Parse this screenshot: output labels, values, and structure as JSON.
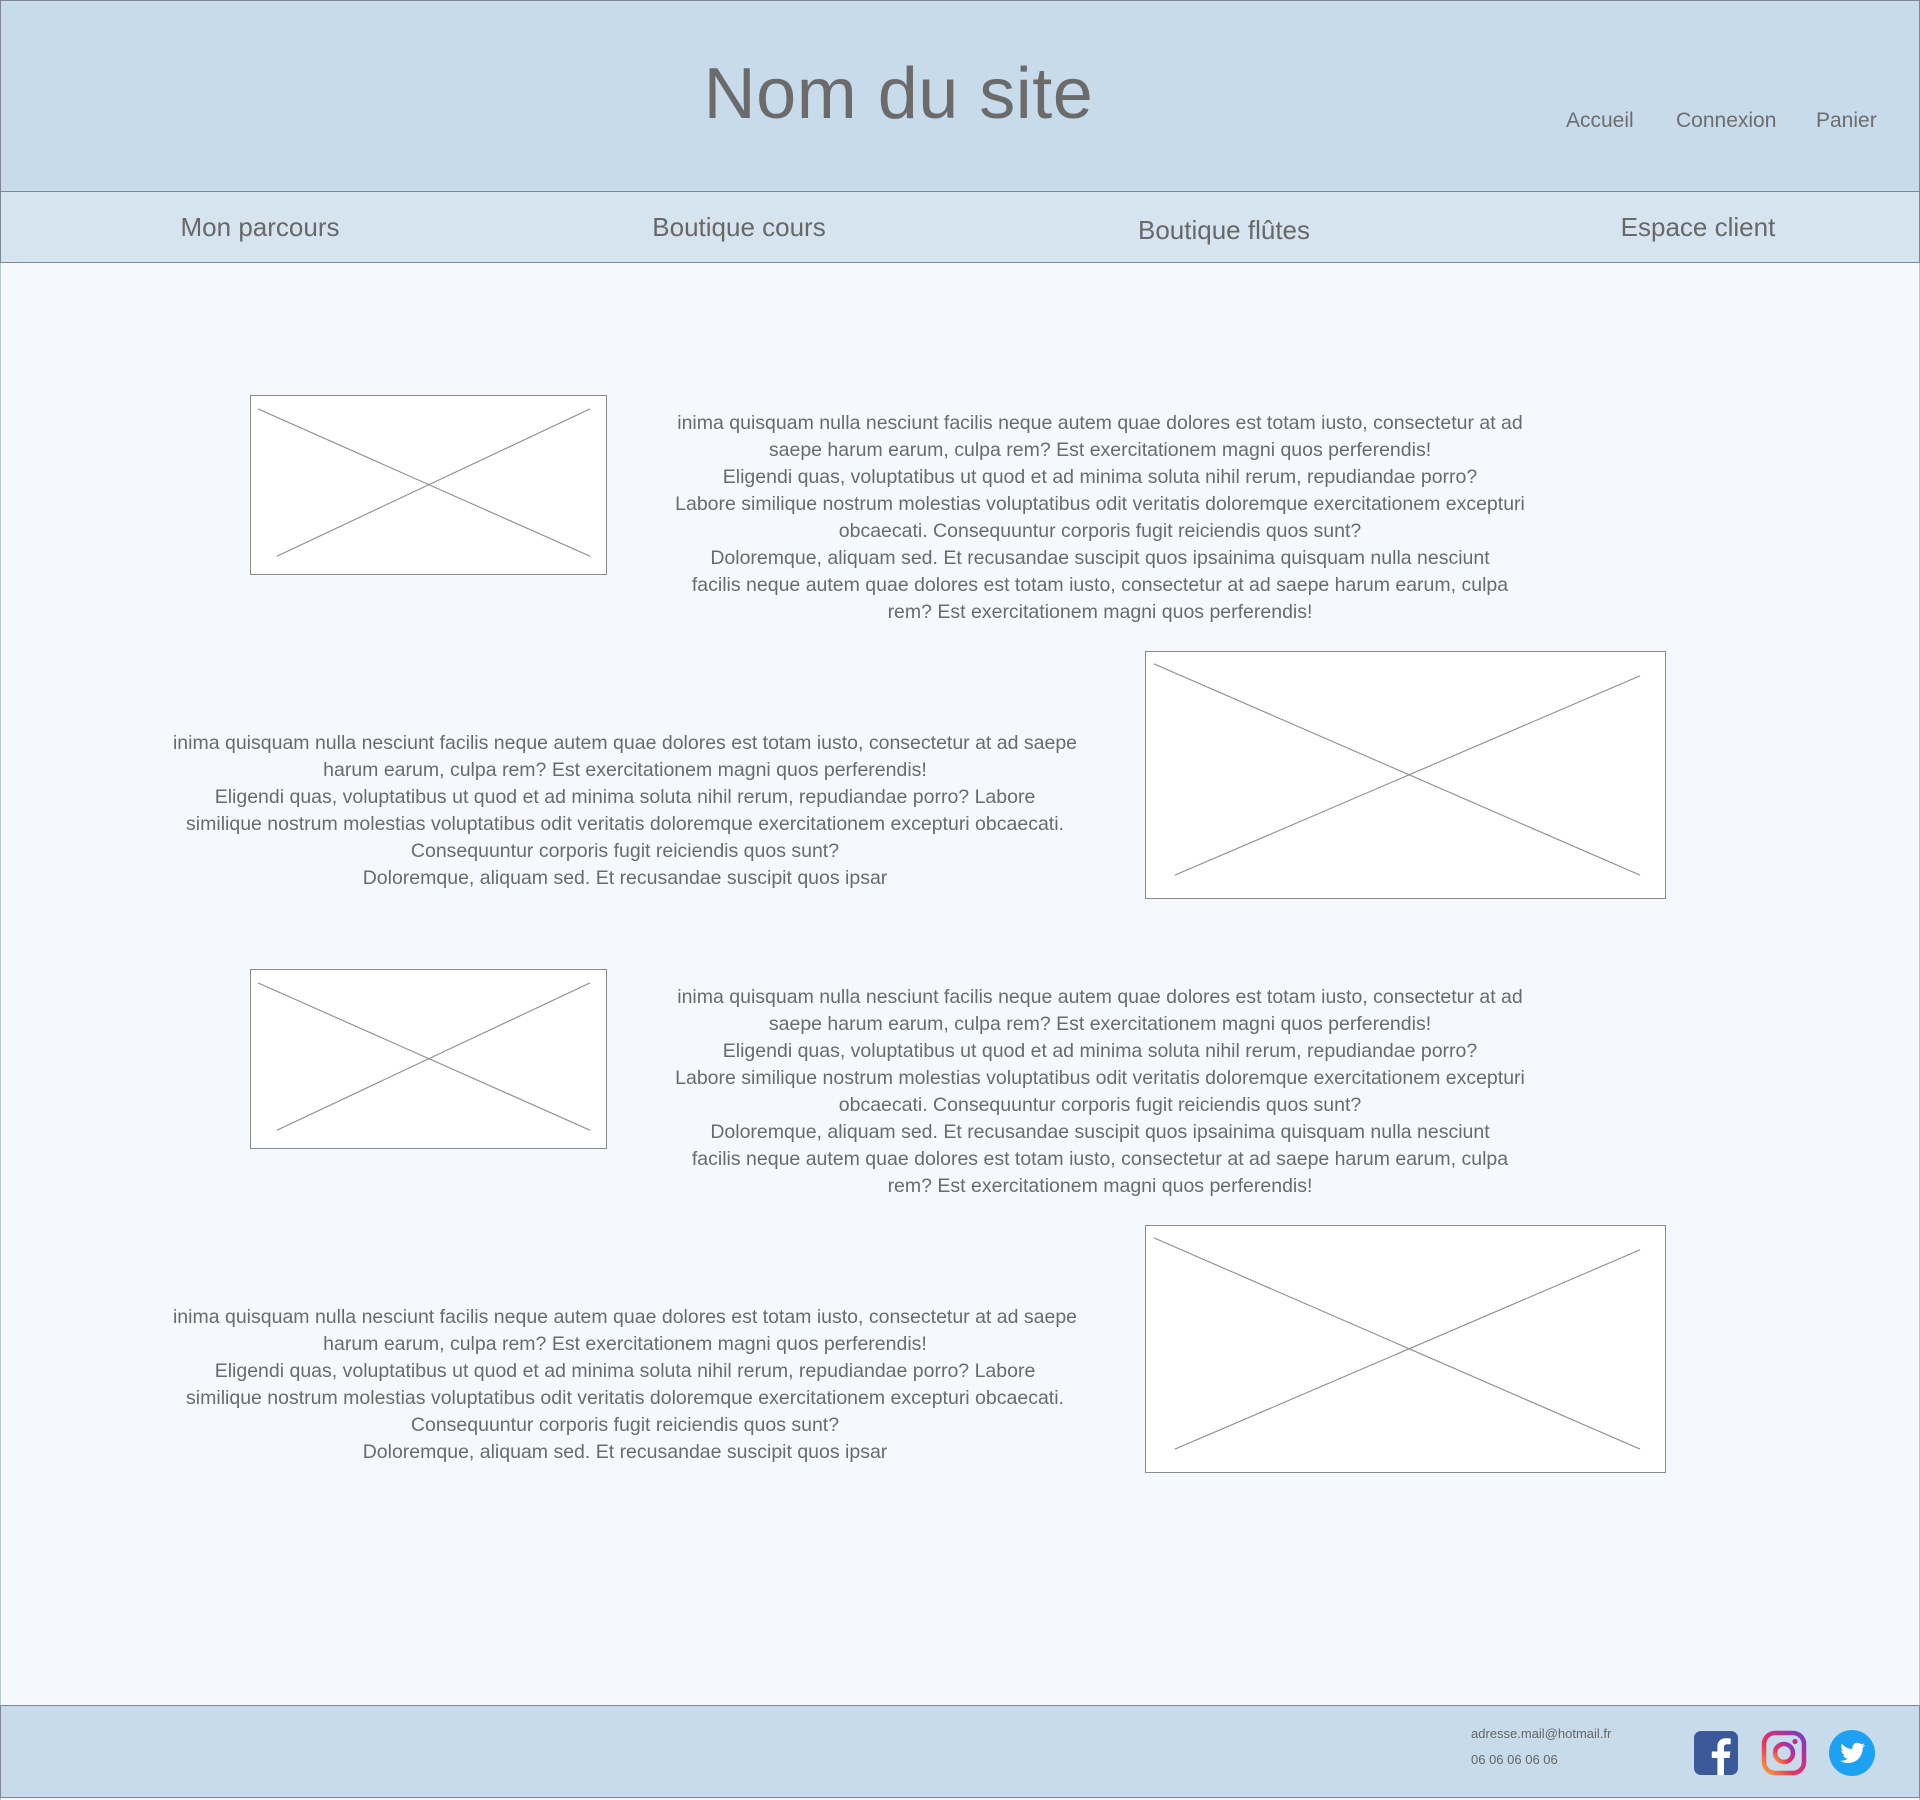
{
  "header": {
    "site_title": "Nom du site",
    "links": [
      "Accueil",
      "Connexion",
      "Panier"
    ]
  },
  "nav": {
    "items": [
      "Mon parcours",
      "Boutique cours",
      "Boutique flûtes",
      "Espace client"
    ]
  },
  "sections": [
    {
      "lines": [
        "inima quisquam nulla nesciunt facilis neque autem quae dolores est totam iusto, consectetur at ad",
        "saepe harum earum, culpa rem? Est exercitationem magni quos perferendis!",
        "Eligendi quas, voluptatibus ut quod et ad minima soluta nihil rerum, repudiandae porro?",
        "Labore similique nostrum molestias voluptatibus odit veritatis doloremque exercitationem excepturi",
        "obcaecati. Consequuntur corporis fugit reiciendis quos sunt?",
        "Doloremque, aliquam sed. Et recusandae suscipit quos ipsainima quisquam nulla nesciunt",
        "facilis neque autem quae dolores est totam iusto, consectetur at ad saepe harum earum, culpa",
        "rem? Est exercitationem magni quos perferendis!"
      ]
    },
    {
      "lines": [
        "inima quisquam nulla nesciunt facilis neque autem quae dolores est totam iusto, consectetur at ad saepe",
        "harum earum, culpa rem? Est exercitationem magni quos perferendis!",
        "Eligendi quas, voluptatibus ut quod et ad minima soluta nihil rerum, repudiandae porro? Labore",
        "similique nostrum molestias voluptatibus odit veritatis doloremque exercitationem excepturi obcaecati.",
        "Consequuntur corporis fugit reiciendis quos sunt?",
        "Doloremque, aliquam sed. Et recusandae suscipit quos ipsar"
      ]
    },
    {
      "lines": [
        "inima quisquam nulla nesciunt facilis neque autem quae dolores est totam iusto, consectetur at ad",
        "saepe harum earum, culpa rem? Est exercitationem magni quos perferendis!",
        "Eligendi quas, voluptatibus ut quod et ad minima soluta nihil rerum, repudiandae porro?",
        "Labore similique nostrum molestias voluptatibus odit veritatis doloremque exercitationem excepturi",
        "obcaecati. Consequuntur corporis fugit reiciendis quos sunt?",
        "Doloremque, aliquam sed. Et recusandae suscipit quos ipsainima quisquam nulla nesciunt",
        "facilis neque autem quae dolores est totam iusto, consectetur at ad saepe harum earum, culpa",
        "rem? Est exercitationem magni quos perferendis!"
      ]
    },
    {
      "lines": [
        "inima quisquam nulla nesciunt facilis neque autem quae dolores est totam iusto, consectetur at ad saepe",
        "harum earum, culpa rem? Est exercitationem magni quos perferendis!",
        "Eligendi quas, voluptatibus ut quod et ad minima soluta nihil rerum, repudiandae porro? Labore",
        "similique nostrum molestias voluptatibus odit veritatis doloremque exercitationem excepturi obcaecati.",
        "Consequuntur corporis fugit reiciendis quos sunt?",
        "Doloremque, aliquam sed. Et recusandae suscipit quos ipsar"
      ]
    }
  ],
  "footer": {
    "email": "adresse.mail@hotmail.fr",
    "phone": "06 06 06 06 06",
    "social_icons": [
      "facebook-icon",
      "instagram-icon",
      "twitter-icon"
    ]
  },
  "colors": {
    "header_bg": "#c7dbeb",
    "nav_bg": "#d5e4ef",
    "page_bg": "#f5f9fd",
    "text": "#676767"
  }
}
